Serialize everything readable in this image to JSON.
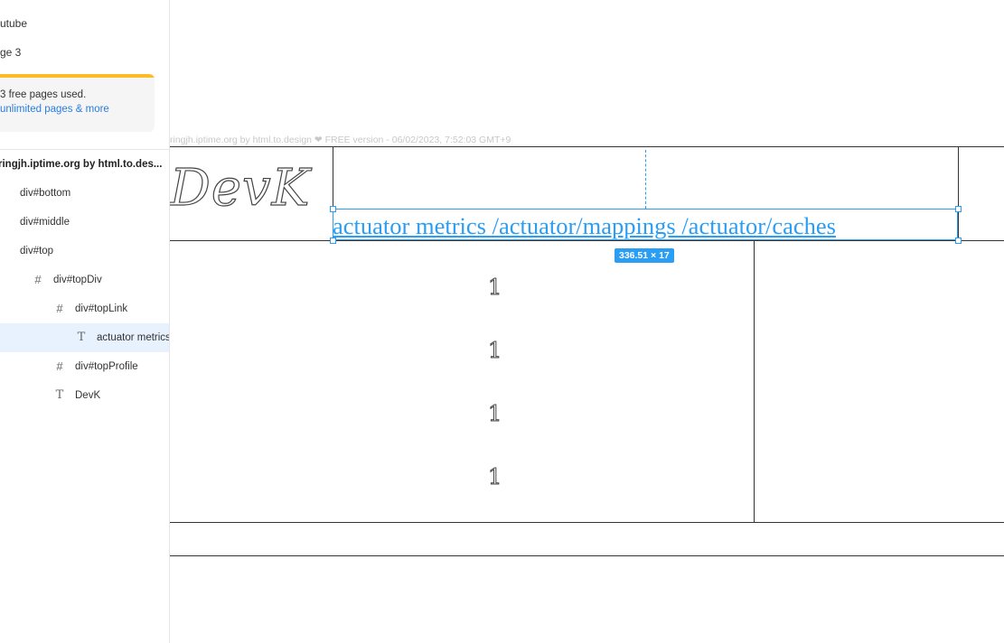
{
  "sidebar": {
    "pages": [
      {
        "label": "utube"
      },
      {
        "label": "ge 3"
      }
    ],
    "upgrade": {
      "text": "3 free pages used.",
      "link": "unlimited pages & more"
    },
    "layers": [
      {
        "label": "ringjh.iptime.org by html.to.des...",
        "icon": "",
        "indent": 0
      },
      {
        "label": "div#bottom",
        "icon": "",
        "indent": 1
      },
      {
        "label": "div#middle",
        "icon": "",
        "indent": 1
      },
      {
        "label": "div#top",
        "icon": "",
        "indent": 1
      },
      {
        "label": "div#topDiv",
        "icon": "frame-icon",
        "indent": 2
      },
      {
        "label": "div#topLink",
        "icon": "frame-icon",
        "indent": 3
      },
      {
        "label": "actuator metrics...",
        "icon": "text-icon",
        "indent": 4,
        "selected": true
      },
      {
        "label": "div#topProfile",
        "icon": "frame-icon",
        "indent": 3
      },
      {
        "label": "DevK",
        "icon": "text-icon",
        "indent": 3
      }
    ]
  },
  "canvas": {
    "frame_label": "ringjh.iptime.org by html.to.design ❤ FREE version - 06/02/2023, 7:52:03 GMT+9",
    "logo": "DevK",
    "link_text": "actuator metrics /actuator/mappings /actuator/caches",
    "size_badge": "336.51 × 17",
    "glyphs": [
      "1",
      "1",
      "1",
      "1"
    ],
    "accent_color": "#2a9df4"
  }
}
